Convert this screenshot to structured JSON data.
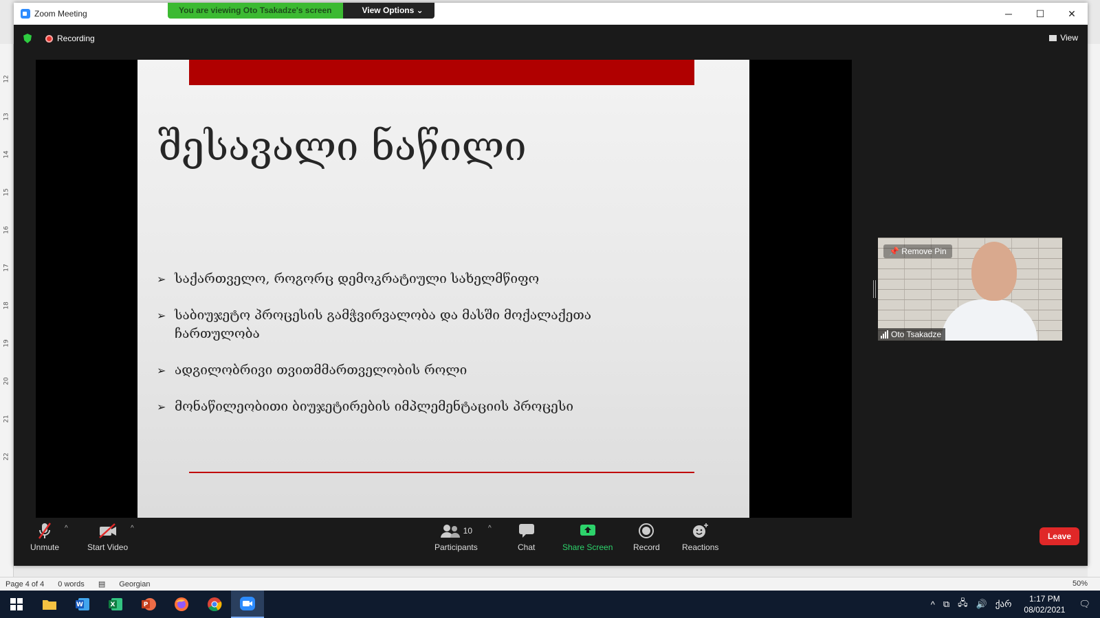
{
  "window": {
    "title": "Zoom Meeting"
  },
  "share_banner": {
    "viewing": "You are viewing Oto Tsakadze's screen",
    "view_options": "View Options"
  },
  "meeting": {
    "recording_label": "Recording",
    "view_label": "View"
  },
  "slide": {
    "title": "შესავალი ნაწილი",
    "bullets": [
      {
        "text": "საქართველო, როგორც დემოკრატიული სახელმწიფო"
      },
      {
        "text": "საბიუჯეტო პროცესის გამჭვირვალობა და მასში მოქალაქეთა ჩართულობა"
      },
      {
        "text": "ადგილობრივი თვითმმართველობის როლი"
      },
      {
        "text": "მონაწილეობითი ბიუჯეტირების იმპლემენტაციის პროცესი"
      }
    ]
  },
  "participant_video": {
    "remove_pin": "Remove Pin",
    "name": "Oto Tsakadze"
  },
  "toolbar": {
    "unmute": "Unmute",
    "start_video": "Start Video",
    "participants": "Participants",
    "participants_count": "10",
    "chat": "Chat",
    "share_screen": "Share Screen",
    "record": "Record",
    "reactions": "Reactions",
    "leave": "Leave"
  },
  "word_status": {
    "page": "Page 4 of 4",
    "words": "0 words",
    "language": "Georgian",
    "zoom": "50%"
  },
  "word_ruler": [
    "12",
    "13",
    "14",
    "15",
    "16",
    "17",
    "18",
    "19",
    "20",
    "21",
    "22"
  ],
  "taskbar": {
    "apps": [
      "file-explorer",
      "word",
      "excel",
      "powerpoint",
      "firefox",
      "chrome",
      "zoom"
    ],
    "input_language": "ქარ",
    "time": "1:17 PM",
    "date": "08/02/2021"
  },
  "colors": {
    "slide_red": "#b00000",
    "zoom_blue": "#2d8cff",
    "share_green": "#3cba32",
    "leave_red": "#e02828"
  }
}
